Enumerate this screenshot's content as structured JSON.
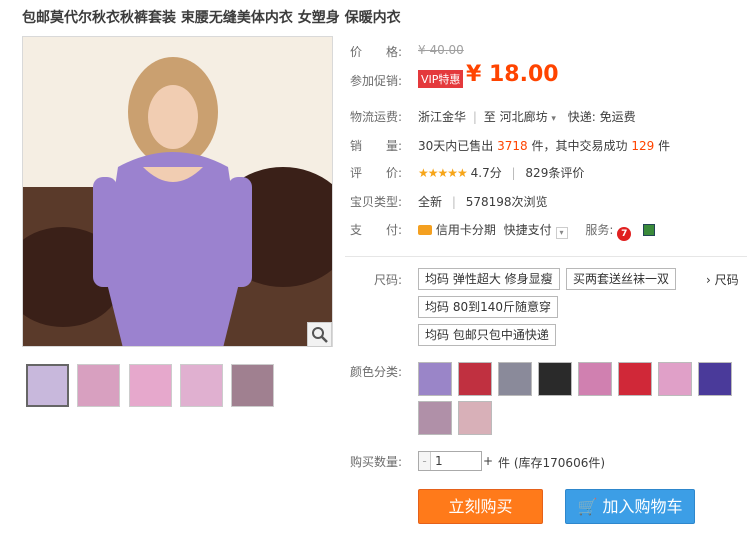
{
  "title": "包邮莫代尔秋衣秋裤套装 束腰无缝美体内衣 女塑身 保暖内衣",
  "price": {
    "label": "价　　格:",
    "original": "¥ 40.00"
  },
  "promo": {
    "label": "参加促销:",
    "badge": "VIP特惠",
    "currency": "¥",
    "value": "18.00"
  },
  "shipping": {
    "label": "物流运费:",
    "from": "浙江金华",
    "sep": "至",
    "to": "河北廊坊",
    "fee": "快递: 免运费"
  },
  "sales": {
    "label": "销　　量:",
    "prefix": "30天内已售出",
    "count": "3718",
    "mid": "件，其中交易成功",
    "success": "129",
    "suffix": "件"
  },
  "rating": {
    "label": "评　　价:",
    "stars": "★★★★★",
    "score": "4.7分",
    "sep": "|",
    "reviews": "829条评价"
  },
  "type": {
    "label": "宝贝类型:",
    "value": "全新",
    "sep": "|",
    "views": "578198次浏览"
  },
  "payment": {
    "label": "支　　付:",
    "credit": "信用卡分期",
    "quick": "快捷支付",
    "service_label": "服务:"
  },
  "size": {
    "label": "尺码:",
    "options": [
      "均码 弹性超大 修身显瘦",
      "买两套送丝袜一双",
      "均码 80到140斤随意穿",
      "均码 包邮只包中通快递"
    ],
    "more": "› 尺码"
  },
  "color": {
    "label": "颜色分类:",
    "swatches": [
      "#9a85c8",
      "#c03040",
      "#8a8a9a",
      "#2a2a2a",
      "#d080b0",
      "#d02838",
      "#e0a0c8",
      "#4a3a9a",
      "#b090a8",
      "#d8b0b8"
    ]
  },
  "qty": {
    "label": "购买数量:",
    "value": "1",
    "unit": "件",
    "stock": "(库存170606件)"
  },
  "buttons": {
    "buy": "立刻购买",
    "cart": "加入购物车"
  },
  "colors": {
    "accent": "#ff4400",
    "buy": "#ff7a1a",
    "cart": "#3c9ee6"
  }
}
